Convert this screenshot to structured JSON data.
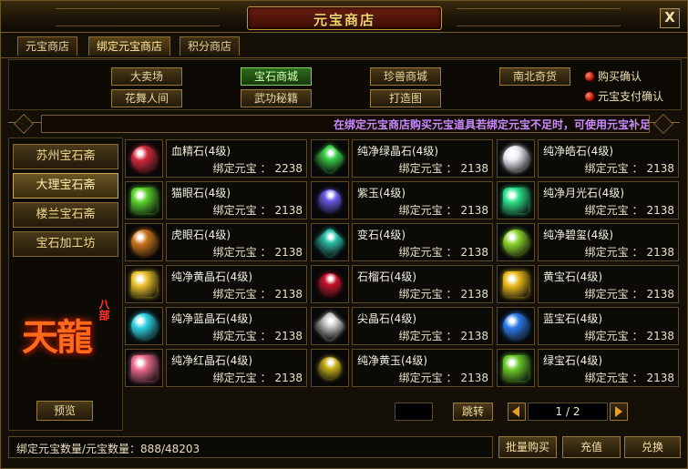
{
  "window": {
    "title": "元宝商店",
    "close_label": "X"
  },
  "tabs": [
    {
      "label": "元宝商店",
      "active": false
    },
    {
      "label": "绑定元宝商店",
      "active": true
    },
    {
      "label": "积分商店",
      "active": false
    }
  ],
  "categories": [
    {
      "label": "大卖场",
      "active": false
    },
    {
      "label": "宝石商城",
      "active": true
    },
    {
      "label": "珍兽商城",
      "active": false
    },
    {
      "label": "南北奇货",
      "active": false
    },
    {
      "label": "花舞人间",
      "active": false
    },
    {
      "label": "武功秘籍",
      "active": false
    },
    {
      "label": "打造图",
      "active": false
    }
  ],
  "options": [
    {
      "label": "购买确认"
    },
    {
      "label": "元宝支付确认"
    }
  ],
  "notice": "在绑定元宝商店购买元宝道具若绑定元宝不足时，可使用元宝补足",
  "sidebar": {
    "items": [
      {
        "label": "苏州宝石斋",
        "active": false
      },
      {
        "label": "大理宝石斋",
        "active": true
      },
      {
        "label": "楼兰宝石斋",
        "active": false
      },
      {
        "label": "宝石加工坊",
        "active": false
      }
    ],
    "logo_text": "天龍",
    "logo_badge": "八部",
    "preview_label": "预览"
  },
  "currency_label": "绑定元宝 ：",
  "items": [
    {
      "name": "血精石(4级)",
      "price": "2238",
      "icon": "red-gem-icon",
      "color": "#d0283a"
    },
    {
      "name": "纯净绿晶石(4级)",
      "price": "2138",
      "icon": "green-crystal-icon",
      "color": "#3ad24a"
    },
    {
      "name": "纯净皓石(4级)",
      "price": "2138",
      "icon": "white-diamond-icon",
      "color": "#e8e8f0"
    },
    {
      "name": "猫眼石(4级)",
      "price": "2138",
      "icon": "green-cat-eye-icon",
      "color": "#58d02a"
    },
    {
      "name": "紫玉(4级)",
      "price": "2138",
      "icon": "purple-jade-icon",
      "color": "#6a5ae8"
    },
    {
      "name": "纯净月光石(4级)",
      "price": "2138",
      "icon": "moonstone-icon",
      "color": "#2ae08a"
    },
    {
      "name": "虎眼石(4级)",
      "price": "2138",
      "icon": "tiger-eye-icon",
      "color": "#c8741a"
    },
    {
      "name": "变石(4级)",
      "price": "2138",
      "icon": "alexandrite-icon",
      "color": "#2ac0a8"
    },
    {
      "name": "纯净碧玺(4级)",
      "price": "2138",
      "icon": "tourmaline-icon",
      "color": "#8ad02a"
    },
    {
      "name": "纯净黄晶石(4级)",
      "price": "2138",
      "icon": "yellow-crystal-icon",
      "color": "#e8c02a"
    },
    {
      "name": "石榴石(4级)",
      "price": "2138",
      "icon": "garnet-icon",
      "color": "#c8122a"
    },
    {
      "name": "黄宝石(4级)",
      "price": "2138",
      "icon": "topaz-icon",
      "color": "#e8b81a"
    },
    {
      "name": "纯净蓝晶石(4级)",
      "price": "2138",
      "icon": "blue-crystal-icon",
      "color": "#2ad0e0"
    },
    {
      "name": "尖晶石(4级)",
      "price": "2138",
      "icon": "spinel-icon",
      "color": "#c8c8c8"
    },
    {
      "name": "蓝宝石(4级)",
      "price": "2138",
      "icon": "sapphire-icon",
      "color": "#2a7ae8"
    },
    {
      "name": "纯净红晶石(4级)",
      "price": "2138",
      "icon": "pink-crystal-icon",
      "color": "#e86a8a"
    },
    {
      "name": "纯净黄玉(4级)",
      "price": "2138",
      "icon": "yellow-jade-icon",
      "color": "#c8b01a"
    },
    {
      "name": "绿宝石(4级)",
      "price": "2138",
      "icon": "emerald-icon",
      "color": "#6ac82a"
    }
  ],
  "pager": {
    "jump_label": "跳转",
    "page_display": "1 / 2"
  },
  "footer": {
    "balance_text": "绑定元宝数量/元宝数量：888/48203",
    "bulk_buy_label": "批量购买",
    "recharge_label": "充值",
    "exchange_label": "兑换"
  }
}
